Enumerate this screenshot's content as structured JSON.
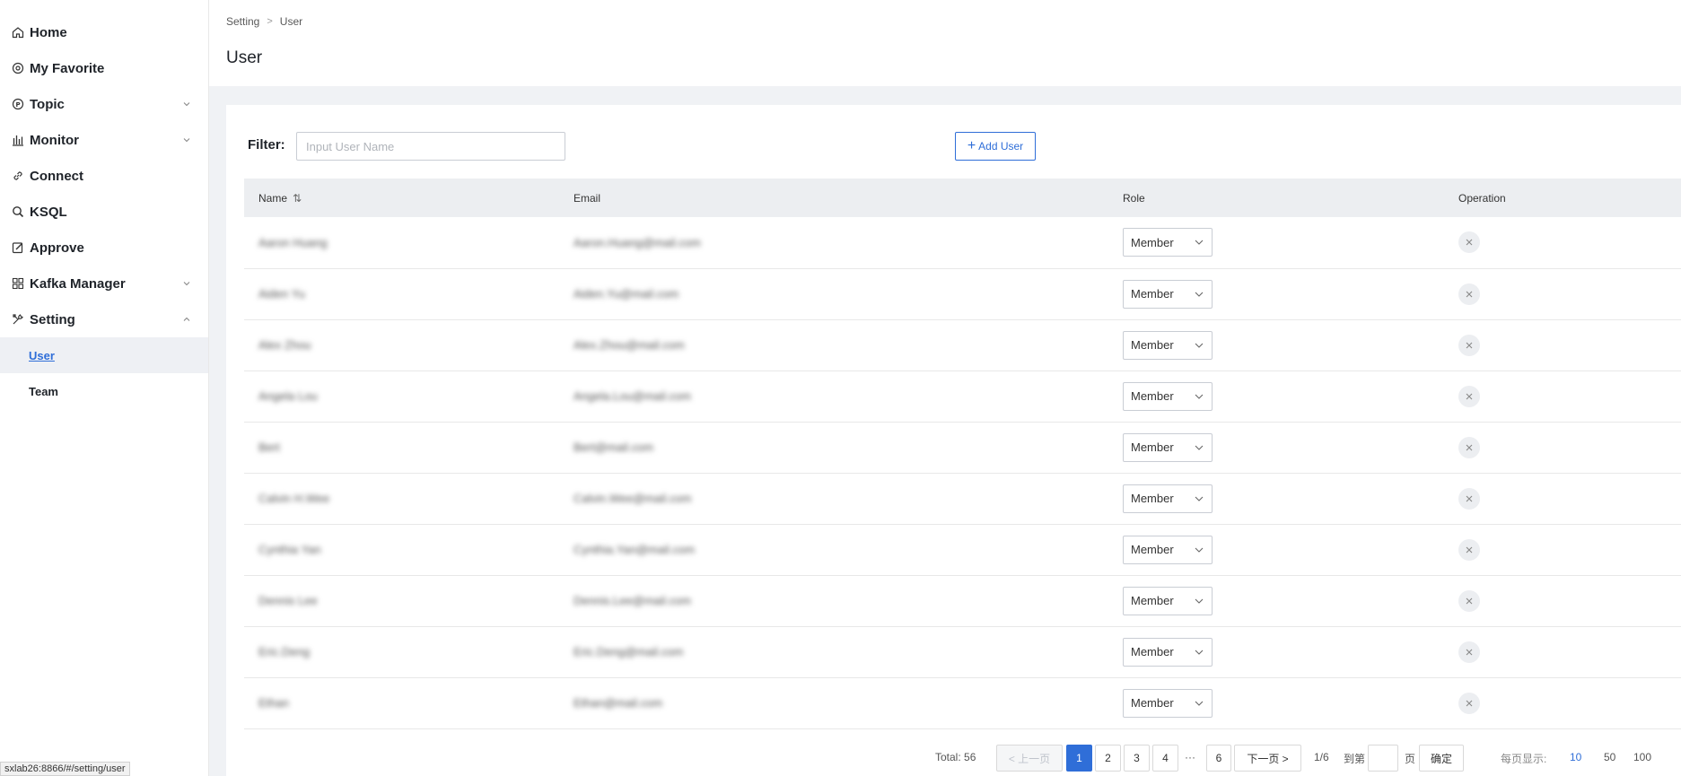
{
  "sidebar": {
    "items": [
      {
        "label": "Home",
        "icon": "home-icon"
      },
      {
        "label": "My Favorite",
        "icon": "favorite-icon"
      },
      {
        "label": "Topic",
        "icon": "topic-icon"
      },
      {
        "label": "Monitor",
        "icon": "monitor-icon"
      },
      {
        "label": "Connect",
        "icon": "link-icon"
      },
      {
        "label": "KSQL",
        "icon": "search-icon"
      },
      {
        "label": "Approve",
        "icon": "edit-icon"
      },
      {
        "label": "Kafka Manager",
        "icon": "grid-icon"
      },
      {
        "label": "Setting",
        "icon": "tools-icon"
      }
    ],
    "setting_children": [
      {
        "label": "User"
      },
      {
        "label": "Team"
      }
    ]
  },
  "header": {
    "breadcrumb": [
      "Setting",
      "User"
    ],
    "title": "User"
  },
  "filter": {
    "label": "Filter:",
    "placeholder": "Input User Name",
    "value": ""
  },
  "add_user": {
    "label": "Add User"
  },
  "table": {
    "columns": [
      "Name",
      "Email",
      "Role",
      "Operation"
    ],
    "rows": [
      {
        "name": "Aaron Huang",
        "email": "Aaron.Huang@mail.com",
        "role": "Member"
      },
      {
        "name": "Aiden Yu",
        "email": "Aiden.Yu@mail.com",
        "role": "Member"
      },
      {
        "name": "Alex Zhou",
        "email": "Alex.Zhou@mail.com",
        "role": "Member"
      },
      {
        "name": "Angela Lou",
        "email": "Angela.Lou@mail.com",
        "role": "Member"
      },
      {
        "name": "Bert",
        "email": "Bert@mail.com",
        "role": "Member"
      },
      {
        "name": "Calvin H.Wee",
        "email": "Calvin.Wee@mail.com",
        "role": "Member"
      },
      {
        "name": "Cynthia Yan",
        "email": "Cynthia.Yan@mail.com",
        "role": "Member"
      },
      {
        "name": "Dennis Lee",
        "email": "Dennis.Lee@mail.com",
        "role": "Member"
      },
      {
        "name": "Eric.Deng",
        "email": "Eric.Deng@mail.com",
        "role": "Member"
      },
      {
        "name": "Ethan",
        "email": "Ethan@mail.com",
        "role": "Member"
      }
    ]
  },
  "pagination": {
    "total_label": "Total: 56",
    "prev_label": "< 上一页",
    "pages": [
      "1",
      "2",
      "3",
      "4",
      "6"
    ],
    "ellipsis": "···",
    "next_label": "下一页 >",
    "page_indicator": "1/6",
    "goto_label": "到第",
    "page_suffix": "页",
    "confirm_label": "确定",
    "per_page_label": "每页显示:",
    "per_page_options": [
      "10",
      "50",
      "100"
    ]
  },
  "status_url": "sxlab26:8866/#/setting/user",
  "colors": {
    "accent": "#2f6ed8",
    "header_bg": "#eceef1"
  }
}
